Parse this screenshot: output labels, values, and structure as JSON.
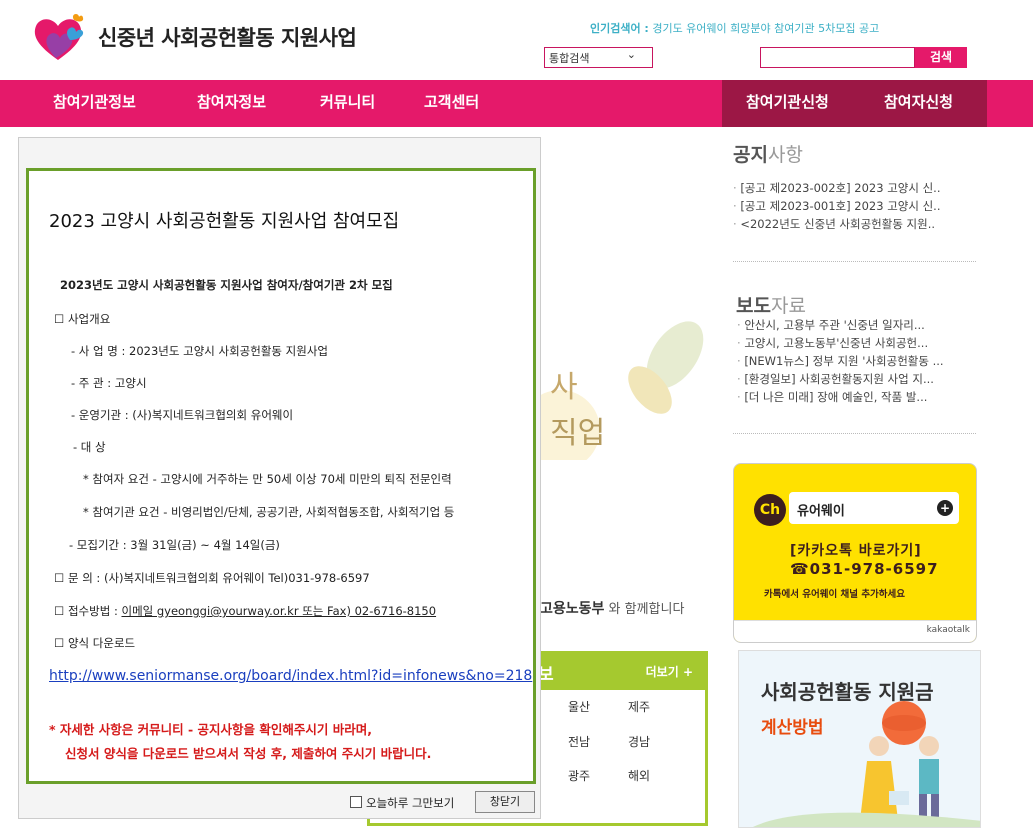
{
  "header": {
    "site_title": "신중년 사회공헌활동 지원사업",
    "popular_label": "인기검색어 :",
    "popular_terms": "경기도 유어웨이  희망분야  참여기관  5차모집  공고",
    "search_select": "통합검색",
    "search_button": "검색"
  },
  "nav": {
    "items": [
      "참여기관정보",
      "참여자정보",
      "커뮤니티",
      "고객센터"
    ],
    "right_items": [
      "참여기관신청",
      "참여자신청"
    ]
  },
  "notice": {
    "title_bold": "공지",
    "title_rest": "사항",
    "items": [
      "[공고 제2023-002호] 2023 고양시 신..",
      "[공고 제2023-001호] 2023 고양시 신..",
      "<2022년도 신중년 사회공헌활동 지원.."
    ]
  },
  "press": {
    "title_bold": "보도",
    "title_rest": "자료",
    "items": [
      "안산시, 고용부 주관 '신중년 일자리...",
      "고양시, 고용노동부'신중년 사회공헌...",
      "[NEW1뉴스] 정부 지원 '사회공헌활동 ...",
      "[환경일보] 사회공헌활동지원 사업 지...",
      "[더 나은 미래] 장애 예술인, 작품 발..."
    ]
  },
  "kakao": {
    "ch": "Ch",
    "channel": "유어웨이",
    "shortcut": "[카카오톡 바로가기]",
    "phone": "☎031-978-6597",
    "hint": "카톡에서 유어웨이 채널 추가하세요",
    "brand": "kakaotalk",
    "colors": {
      "bg": "#ffe100",
      "dark": "#3c1e1e"
    }
  },
  "subsidy": {
    "title": "사회공헌활동 지원금",
    "subtitle": "계산방법"
  },
  "background": {
    "watermark_1": "사",
    "watermark_2": "직업",
    "ministry": "고용노동부",
    "ministry_rest": "와 함께합니다",
    "region_title_partial": "보",
    "region_more": "더보기 +",
    "regions": [
      "울산",
      "제주",
      "전남",
      "경남",
      "광주",
      "해외"
    ]
  },
  "popup": {
    "title": "2023 고양시 사회공헌활동 지원사업 참여모집",
    "subtitle": "2023년도 고양시 사회공헌활동 지원사업 참여자/참여기관 2차 모집",
    "lines": [
      "☐ 사업개요",
      "- 사 업 명 : 2023년도 고양시 사회공헌활동 지원사업",
      "- 주        관 : 고양시",
      "- 운영기관 : (사)복지네트워크협의회 유어웨이",
      "- 대        상",
      "* 참여자 요건 - 고양시에 거주하는 만 50세 이상 70세 미만의 퇴직 전문인력",
      "* 참여기관 요건 - 비영리법인/단체, 공공기관, 사회적협동조합, 사회적기업 등",
      "- 모집기간 : 3월 31일(금) ~ 4월 14일(금)",
      "☐ 문 의 : (사)복지네트워크협의회 유어웨이 Tel)031-978-6597",
      "☐ 접수방법 : ",
      "☐ 양식 다운로드"
    ],
    "submit_method": "이메일 gyeonggi@yourway.or.kr 또는 Fax) 02-6716-8150",
    "link": "http://www.seniormanse.org/board/index.html?id=infonews&no=218",
    "notice_1": "* 자세한 사항은 커뮤니티 - 공지사항을 확인해주시기 바라며,",
    "notice_2": "신청서 양식을 다운로드 받으셔서 작성 후, 제출하여 주시기 바랍니다.",
    "dont_show": "오늘하루 그만보기",
    "close": "창닫기"
  }
}
